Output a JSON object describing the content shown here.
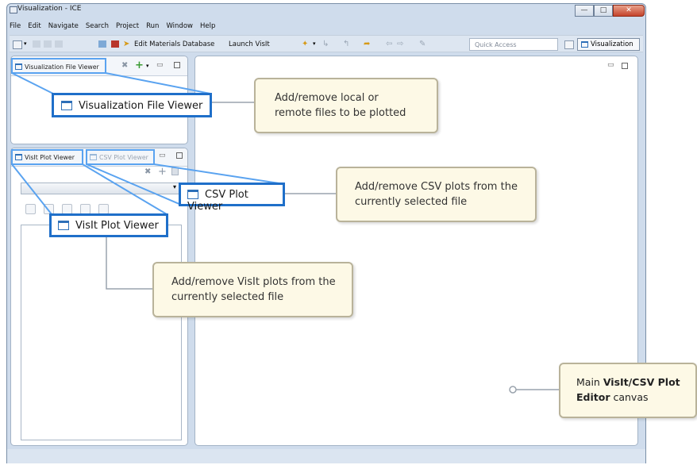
{
  "window": {
    "title": "Visualization - ICE",
    "buttons": [
      "minimize",
      "maximize",
      "close"
    ]
  },
  "menu": [
    "File",
    "Edit",
    "Navigate",
    "Search",
    "Project",
    "Run",
    "Window",
    "Help"
  ],
  "toolbar": {
    "edit_materials": "Edit Materials Database",
    "launch_visit": "Launch VisIt",
    "quick_access_placeholder": "Quick Access",
    "perspective": "Visualization"
  },
  "panels": {
    "file_viewer_tab": "Visualization File Viewer",
    "visit_plot_tab": "VisIt Plot Viewer",
    "csv_plot_tab": "CSV Plot Viewer"
  },
  "annotations": {
    "file_viewer_label": "Visualization File Viewer",
    "file_viewer_callout": "Add/remove local or remote files to be plotted",
    "csv_label": "CSV Plot Viewer",
    "csv_callout": "Add/remove CSV plots from the currently selected file",
    "visit_label": "VisIt Plot Viewer",
    "visit_callout": "Add/remove VisIt plots from the currently selected file",
    "main_prefix": "Main ",
    "main_bold": "VisIt/CSV Plot Editor",
    "main_suffix": " canvas"
  },
  "colors": {
    "highlight_blue": "#1f6fc9",
    "connector_blue": "#5aa3f0",
    "callout_bg": "#fdf9e6",
    "window_frame": "#cfdcec"
  },
  "icons": [
    "app-icon",
    "new-icon",
    "save-icon",
    "materials-icon",
    "launch-icon",
    "view-icon",
    "gear-icon",
    "plus-icon",
    "minimize-icon",
    "maximize-icon"
  ]
}
